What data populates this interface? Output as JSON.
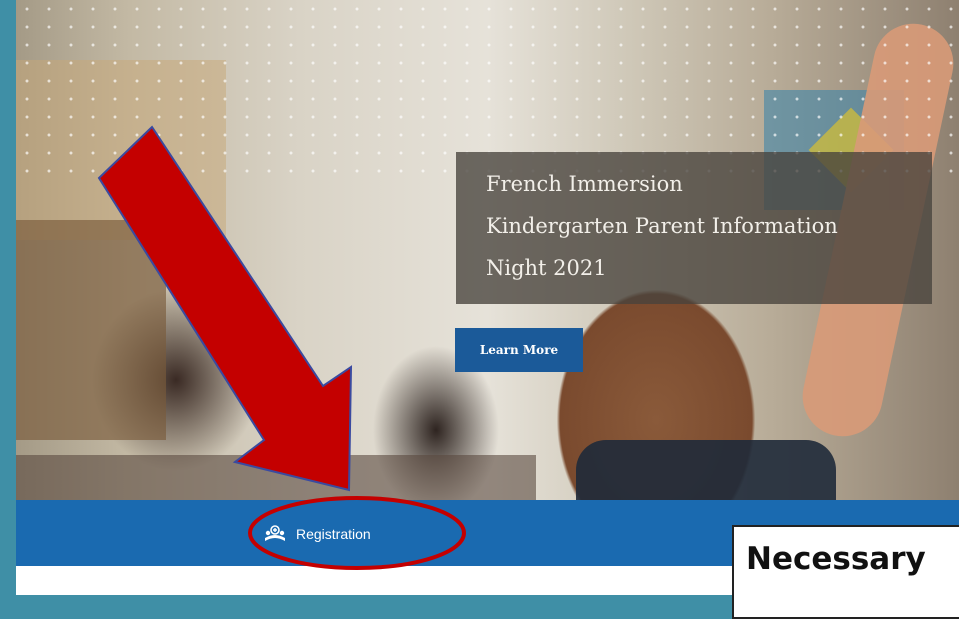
{
  "hero": {
    "title_lines": [
      "French Immersion",
      "Kindergarten Parent Information",
      "Night 2021"
    ],
    "cta_label": "Learn More"
  },
  "navbar": {
    "items": [
      {
        "label": "Registration",
        "icon": "registration-icon"
      }
    ]
  },
  "annotation": {
    "callout_text": "Necessary",
    "arrow_color": "#c40000",
    "circle_color": "#c40000"
  },
  "colors": {
    "navbar": "#1a6ab0",
    "button": "#1b5a99",
    "frame": "#3f8fa6"
  }
}
